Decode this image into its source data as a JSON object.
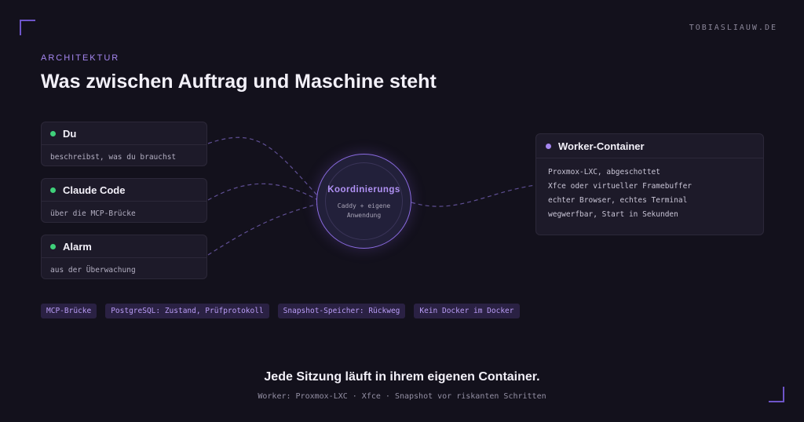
{
  "brand": "TOBIASLIAUW.DE",
  "eyebrow": "ARCHITEKTUR",
  "title": "Was zwischen Auftrag und Maschine steht",
  "inputs": [
    {
      "title": "Du",
      "sub": "beschreibst, was du brauchst"
    },
    {
      "title": "Claude Code",
      "sub": "über die MCP-Brücke"
    },
    {
      "title": "Alarm",
      "sub": "aus der Überwachung"
    }
  ],
  "hub": {
    "title": "Koordinierungs",
    "desc": "Caddy + eigene Anwendung"
  },
  "worker": {
    "title": "Worker-Container",
    "lines": [
      "Proxmox-LXC, abgeschottet",
      "Xfce oder virtueller Framebuffer",
      "echter Browser, echtes Terminal",
      "wegwerfbar, Start in Sekunden"
    ]
  },
  "tags": [
    "MCP-Brücke",
    "PostgreSQL: Zustand, Prüfprotokoll",
    "Snapshot-Speicher: Rückweg",
    "Kein Docker im Docker"
  ],
  "footer": {
    "main": "Jede Sitzung läuft in ihrem eigenen Container.",
    "sub": "Worker: Proxmox-LXC · Xfce · Snapshot vor riskanten Schritten"
  },
  "colors": {
    "background": "#13111c",
    "accent": "#a586f0",
    "input_dot": "#3fd07a"
  }
}
